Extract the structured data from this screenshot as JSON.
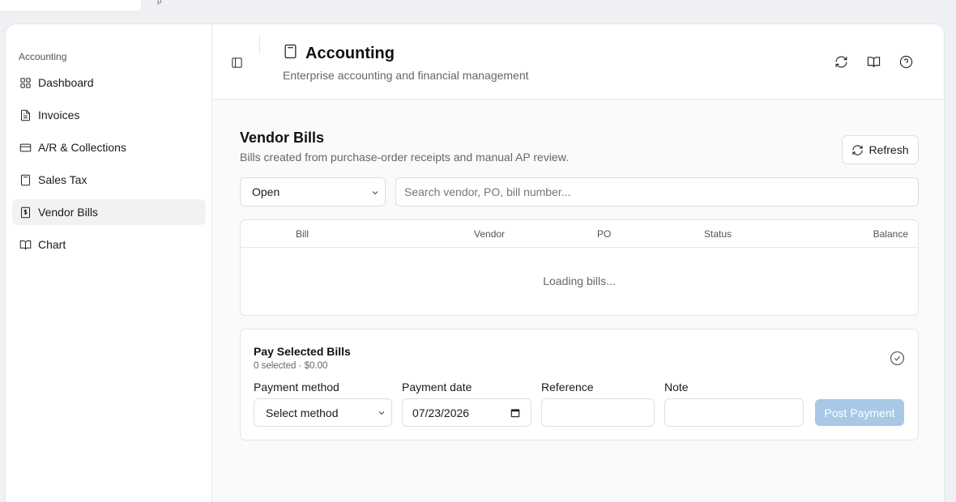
{
  "tabstrip": {
    "fragment_text": "p"
  },
  "sidebar": {
    "group_label": "Accounting",
    "items": [
      {
        "label": "Dashboard",
        "icon": "layout-grid-icon",
        "active": false
      },
      {
        "label": "Invoices",
        "icon": "file-text-icon",
        "active": false
      },
      {
        "label": "A/R & Collections",
        "icon": "credit-card-icon",
        "active": false
      },
      {
        "label": "Sales Tax",
        "icon": "calculator-icon",
        "active": false
      },
      {
        "label": "Vendor Bills",
        "icon": "receipt-dollar-icon",
        "active": true
      },
      {
        "label": "Chart",
        "icon": "book-open-icon",
        "active": false
      }
    ]
  },
  "header": {
    "title": "Accounting",
    "subtitle": "Enterprise accounting and financial management",
    "actions": [
      "refresh-icon",
      "book-open-icon",
      "help-circle-icon"
    ]
  },
  "vendor_bills": {
    "title": "Vendor Bills",
    "subtitle": "Bills created from purchase-order receipts and manual AP review.",
    "refresh_label": "Refresh",
    "status_filter": "Open",
    "search_placeholder": "Search vendor, PO, bill number...",
    "columns": [
      "Bill",
      "Vendor",
      "PO",
      "Status",
      "Balance"
    ],
    "loading_text": "Loading bills..."
  },
  "payment": {
    "title": "Pay Selected Bills",
    "summary": "0 selected · $0.00",
    "method_label": "Payment method",
    "method_value": "Select method",
    "date_label": "Payment date",
    "date_value": "07/23/2026",
    "reference_label": "Reference",
    "reference_value": "",
    "note_label": "Note",
    "note_value": "",
    "post_label": "Post Payment"
  },
  "colors": {
    "accent_disabled": "#a8c8e6",
    "active_nav_bg": "#f1f2f4"
  }
}
